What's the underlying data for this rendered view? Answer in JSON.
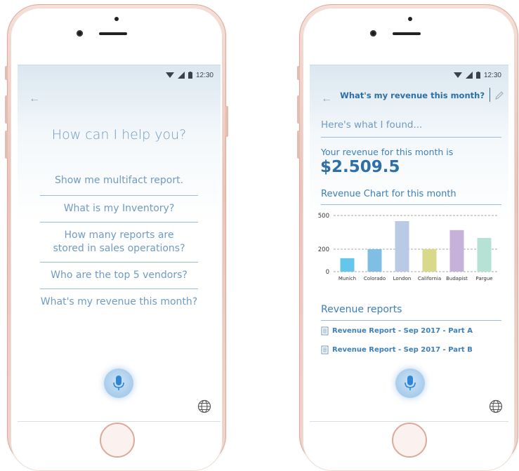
{
  "status_bar": {
    "time": "12:30"
  },
  "left_screen": {
    "title": "How can I help you?",
    "suggestions": [
      {
        "label": "Show me multifact report."
      },
      {
        "label": "What is my Inventory?"
      },
      {
        "label": "How many reports are stored in sales operations?"
      },
      {
        "label": "Who are the top 5 vendors?"
      },
      {
        "label": "What's my revenue this month?"
      }
    ]
  },
  "right_screen": {
    "query": "What's my revenue this month?",
    "found_text": "Here's what I found...",
    "revenue_label": "Your revenue for this month is",
    "revenue_value": "$2.509.5",
    "chart_title": "Revenue Chart for this month",
    "reports_title": "Revenue  reports",
    "reports": [
      {
        "label": "Revenue  Report - Sep 2017 - Part A"
      },
      {
        "label": "Revenue  Report - Sep 2017 - Part B"
      }
    ]
  },
  "icons": {
    "back": "arrow-left-icon",
    "mic": "microphone-icon",
    "globe": "globe-icon",
    "edit": "pencil-icon",
    "report": "document-icon",
    "wifi": "wifi-icon",
    "signal": "signal-icon",
    "battery": "battery-icon"
  },
  "colors": {
    "accent": "#3d7fb8",
    "suggestion_text": "#6f9bc4",
    "phone_frame": "#f1d5cc"
  },
  "chart_data": {
    "type": "bar",
    "title": "Revenue Chart for this month",
    "categories": [
      "Munich",
      "Colorado",
      "London",
      "California",
      "Budapist",
      "Pargue"
    ],
    "values": [
      120,
      200,
      450,
      200,
      370,
      300
    ],
    "colors": [
      "#63c6ea",
      "#7fbfe6",
      "#b9c9e6",
      "#d8d98a",
      "#c6b1d8",
      "#b6e2d6"
    ],
    "yticks": [
      0,
      200,
      500
    ],
    "ylim": [
      0,
      500
    ],
    "grid": true
  }
}
